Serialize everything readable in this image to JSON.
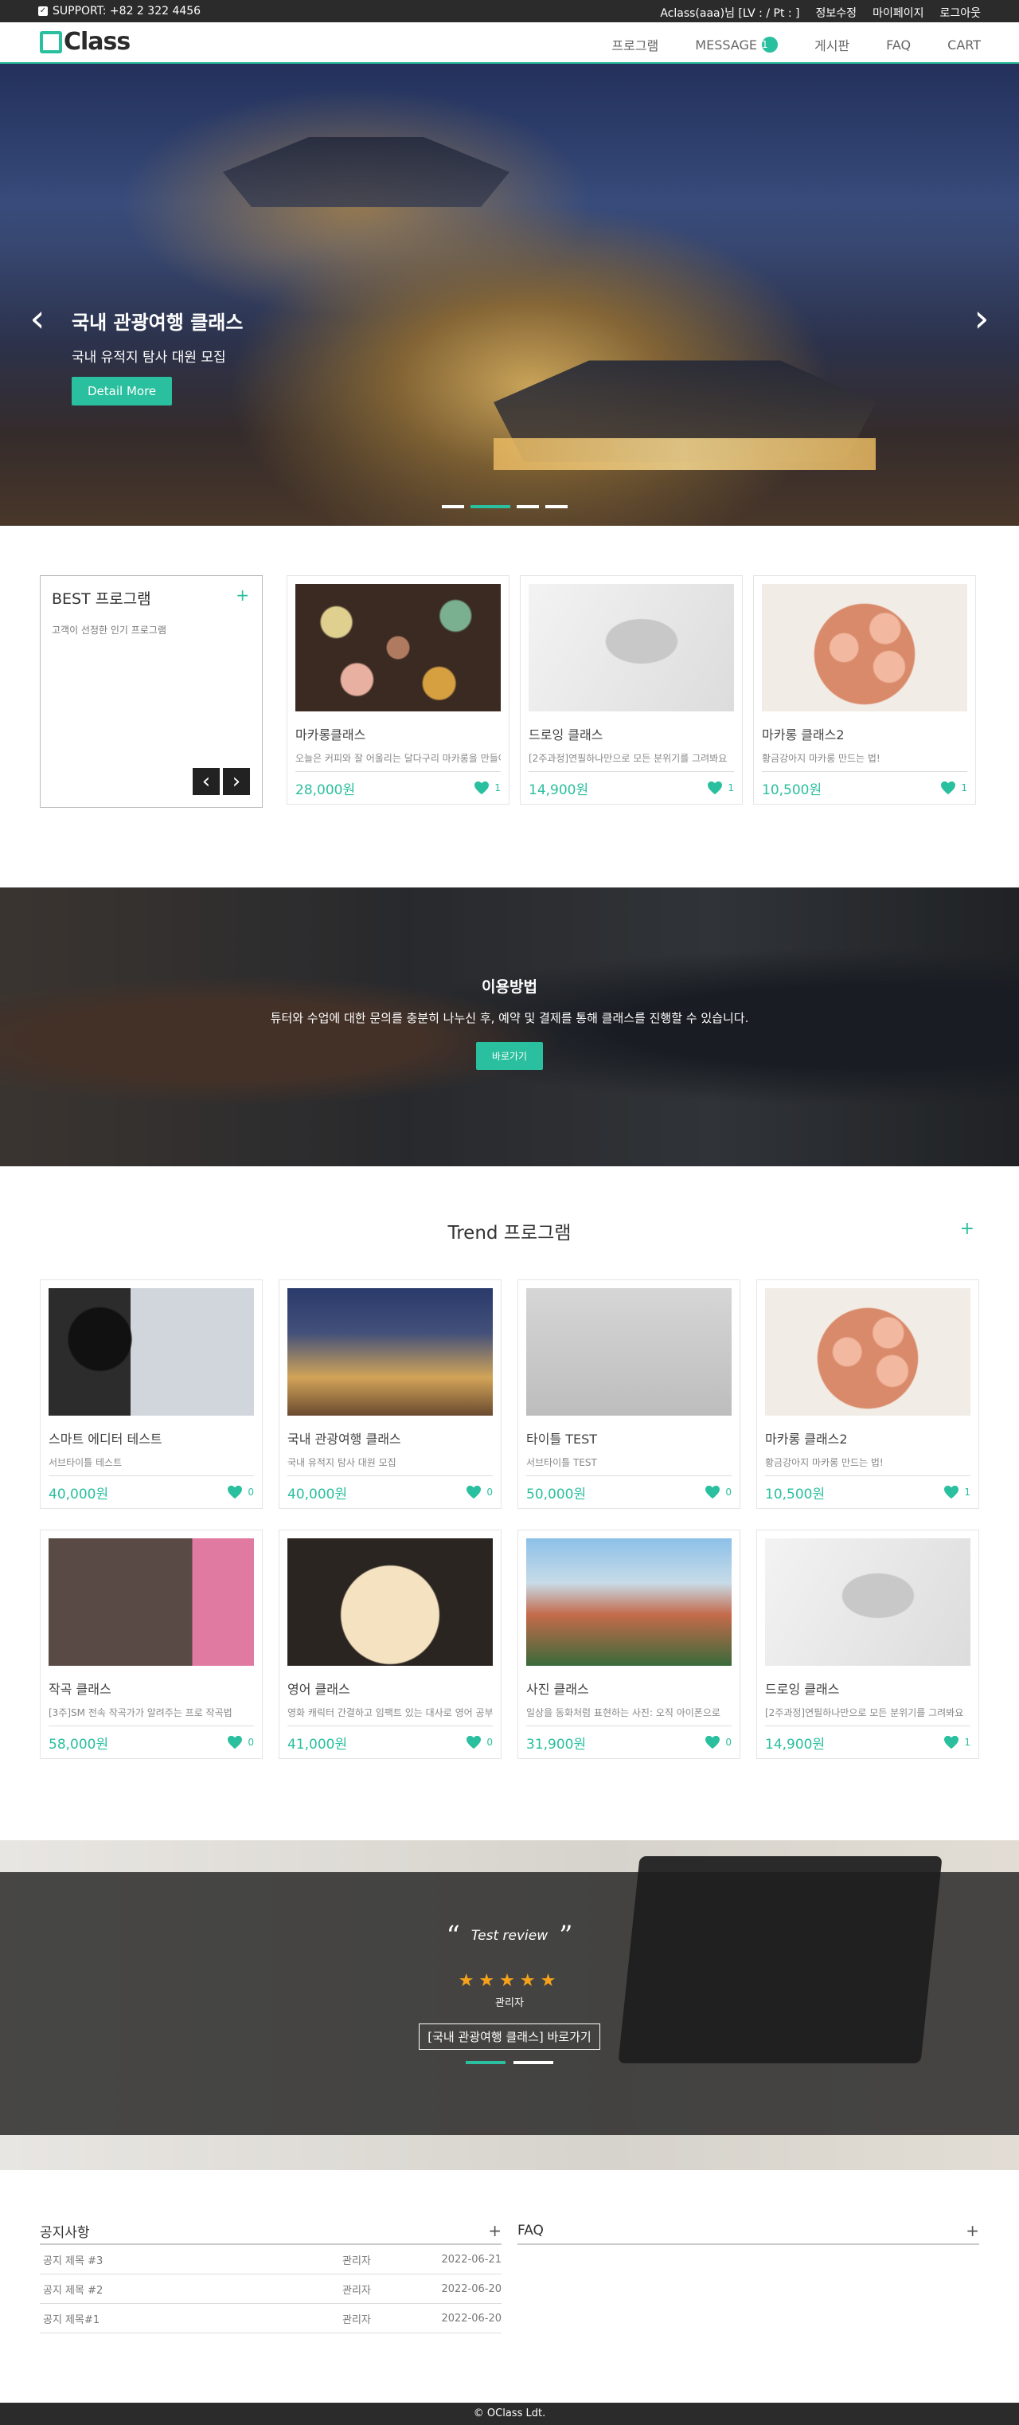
{
  "topbar": {
    "support": "SUPPORT: +82 2 322 4456",
    "user": "Aclass(aaa)님 [LV : / Pt : ]",
    "edit": "정보수정",
    "mypage": "마이페이지",
    "logout": "로그아웃"
  },
  "header": {
    "logo": "Class",
    "nav": [
      "프로그램",
      "MESSAGE",
      "게시판",
      "FAQ",
      "CART"
    ],
    "message_count": "1"
  },
  "hero": {
    "title": "국내 관광여행 클래스",
    "subtitle": "국내 유적지 탐사 대원 모집",
    "button": "Detail More",
    "prev": "‹",
    "next": "›"
  },
  "best": {
    "title": "BEST 프로그램",
    "plus": "+",
    "desc": "고객이 선정한 인기 프로그램",
    "prev": "‹",
    "next": "›",
    "items": [
      {
        "title": "마카롱클래스",
        "sub": "오늘은 커피와 잘 어울리는 달다구리 마카롱을 만들어요",
        "price": "28,000원",
        "likes": "1"
      },
      {
        "title": "드로잉 클래스",
        "sub": "[2주과정]연필하나만으로 모든 분위기를 그려봐요",
        "price": "14,900원",
        "likes": "1"
      },
      {
        "title": "마카롱 클래스2",
        "sub": "황금강아지 마카롱 만드는 법!",
        "price": "10,500원",
        "likes": "1"
      }
    ]
  },
  "howto": {
    "title": "이용방법",
    "desc": "튜터와 수업에 대한 문의를 충분히 나누신 후, 예약 및 결제를 통해 클래스를 진행할 수 있습니다.",
    "button": "바로가기"
  },
  "trend": {
    "title": "Trend 프로그램",
    "plus": "+",
    "items": [
      {
        "title": "스마트 에디터 테스트",
        "sub": "서브타이틀 테스트",
        "price": "40,000원",
        "likes": "0"
      },
      {
        "title": "국내 관광여행 클래스",
        "sub": "국내 유적지 탐사 대원 모집",
        "price": "40,000원",
        "likes": "0"
      },
      {
        "title": "타이틀 TEST",
        "sub": "서브타이틀 TEST",
        "price": "50,000원",
        "likes": "0"
      },
      {
        "title": "마카롱 클래스2",
        "sub": "황금강아지 마카롱 만드는 법!",
        "price": "10,500원",
        "likes": "1"
      },
      {
        "title": "작곡 클래스",
        "sub": "[3주]SM 전속 작곡가가 알려주는 프로 작곡법",
        "price": "58,000원",
        "likes": "0"
      },
      {
        "title": "영어 클래스",
        "sub": "영화 캐릭터 간결하고 임팩트 있는 대사로 영어 공부",
        "price": "41,000원",
        "likes": "0"
      },
      {
        "title": "사진 클래스",
        "sub": "일상을 동화처럼 표현하는 사진: 오직 아이폰으로",
        "price": "31,900원",
        "likes": "0"
      },
      {
        "title": "드로잉 클래스",
        "sub": "[2주과정]연필하나만으로 모든 분위기를 그려봐요",
        "price": "14,900원",
        "likes": "1"
      }
    ]
  },
  "review": {
    "open_quote": "“",
    "close_quote": "”",
    "text": "Test review",
    "stars": "★★★★★",
    "author": "관리자",
    "button": "[국내 관광여행 클래스] 바로가기"
  },
  "notice": {
    "title": "공지사항",
    "plus": "+",
    "rows": [
      {
        "subject": "공지 제목 #3",
        "writer": "관리자",
        "date": "2022-06-21"
      },
      {
        "subject": "공지 제목 #2",
        "writer": "관리자",
        "date": "2022-06-20"
      },
      {
        "subject": "공지 제목#1",
        "writer": "관리자",
        "date": "2022-06-20"
      }
    ]
  },
  "faq": {
    "title": "FAQ",
    "plus": "+"
  },
  "footer": {
    "copyright": "© OClass Ldt."
  },
  "colors": {
    "accent": "#2abf9e",
    "dark": "#2b2b2b",
    "star": "#f7a21b"
  },
  "icons": {
    "heart": "heart-icon",
    "check": "checkbox-icon"
  }
}
